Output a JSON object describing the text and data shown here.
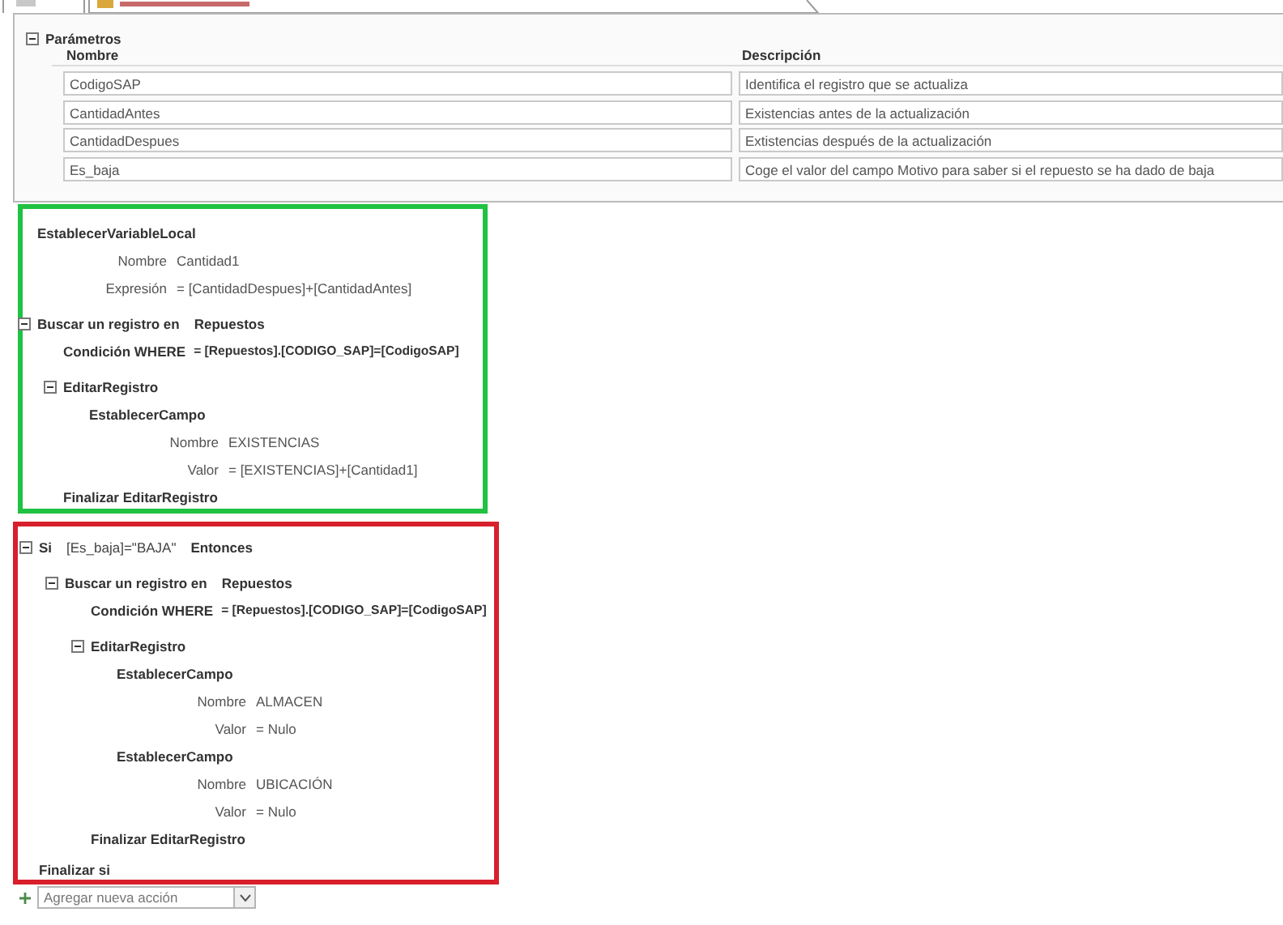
{
  "parameters": {
    "title": "Parámetros",
    "expanded": true,
    "columns": [
      "Nombre",
      "Descripción"
    ],
    "rows": [
      {
        "name": "CodigoSAP",
        "description": "Identifica el registro que se actualiza"
      },
      {
        "name": "CantidadAntes",
        "description": "Existencias antes de la actualización"
      },
      {
        "name": "CantidadDespues",
        "description": "Extistencias después de la actualización"
      },
      {
        "name": "Es_baja",
        "description": "Coge el valor del campo Motivo para saber si el repuesto se ha dado de baja"
      }
    ]
  },
  "groups": [
    {
      "color": "#1fc241",
      "items": [
        {
          "kind": "action",
          "title": "EstablecerVariableLocal",
          "args": [
            {
              "label": "Nombre",
              "value": "Cantidad1"
            },
            {
              "label": "Expresión",
              "value": "= [CantidadDespues]+[CantidadAntes]"
            }
          ]
        },
        {
          "kind": "lookup",
          "expanded": true,
          "label": "Buscar un registro en",
          "table": "Repuestos",
          "where_label": "Condición WHERE",
          "where": "= [Repuestos].[CODIGO_SAP]=[CodigoSAP]",
          "children": [
            {
              "kind": "edit",
              "expanded": true,
              "title": "EditarRegistro",
              "end": "Finalizar EditarRegistro",
              "children": [
                {
                  "kind": "action",
                  "title": "EstablecerCampo",
                  "args": [
                    {
                      "label": "Nombre",
                      "value": "EXISTENCIAS"
                    },
                    {
                      "label": "Valor",
                      "value": "= [EXISTENCIAS]+[Cantidad1]"
                    }
                  ]
                }
              ]
            }
          ]
        }
      ]
    },
    {
      "color": "#d7202b",
      "items": [
        {
          "kind": "if",
          "expanded": true,
          "label": "Si",
          "condition": "[Es_baja]=\"BAJA\"",
          "then": "Entonces",
          "end": "Finalizar si",
          "children": [
            {
              "kind": "lookup",
              "expanded": true,
              "label": "Buscar un registro en",
              "table": "Repuestos",
              "where_label": "Condición WHERE",
              "where": "= [Repuestos].[CODIGO_SAP]=[CodigoSAP]",
              "children": [
                {
                  "kind": "edit",
                  "expanded": true,
                  "title": "EditarRegistro",
                  "end": "Finalizar EditarRegistro",
                  "children": [
                    {
                      "kind": "action",
                      "title": "EstablecerCampo",
                      "args": [
                        {
                          "label": "Nombre",
                          "value": "ALMACEN"
                        },
                        {
                          "label": "Valor",
                          "value": "= Nulo"
                        }
                      ]
                    },
                    {
                      "kind": "action",
                      "title": "EstablecerCampo",
                      "args": [
                        {
                          "label": "Nombre",
                          "value": "UBICACIÓN"
                        },
                        {
                          "label": "Valor",
                          "value": "= Nulo"
                        }
                      ]
                    }
                  ]
                }
              ]
            }
          ]
        }
      ]
    }
  ],
  "add_action": {
    "placeholder": "Agregar nueva acción"
  }
}
